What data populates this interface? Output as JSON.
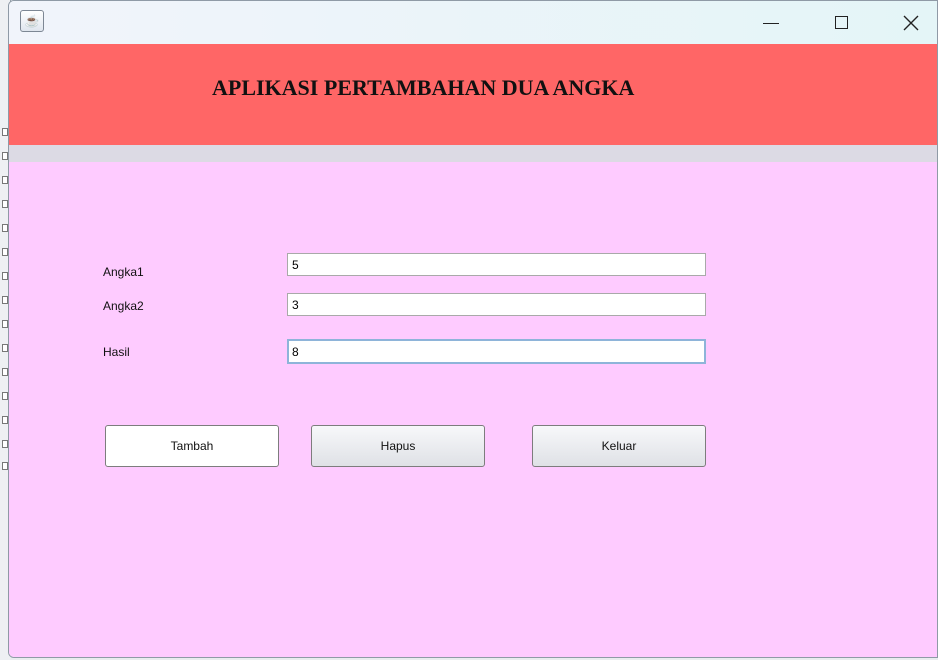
{
  "window": {
    "app_icon": "java-icon",
    "controls": {
      "minimize": "minimize-icon",
      "maximize": "maximize-icon",
      "close": "close-icon"
    }
  },
  "header": {
    "title": "APLIKASI PERTAMBAHAN DUA ANGKA"
  },
  "form": {
    "angka1": {
      "label": "Angka1",
      "value": "5"
    },
    "angka2": {
      "label": "Angka2",
      "value": "3"
    },
    "hasil": {
      "label": "Hasil",
      "value": "8"
    }
  },
  "buttons": {
    "tambah": "Tambah",
    "hapus": "Hapus",
    "keluar": "Keluar"
  },
  "colors": {
    "header": "#ff6666",
    "panel": "#fecbff",
    "divider": "#dcdae4"
  }
}
